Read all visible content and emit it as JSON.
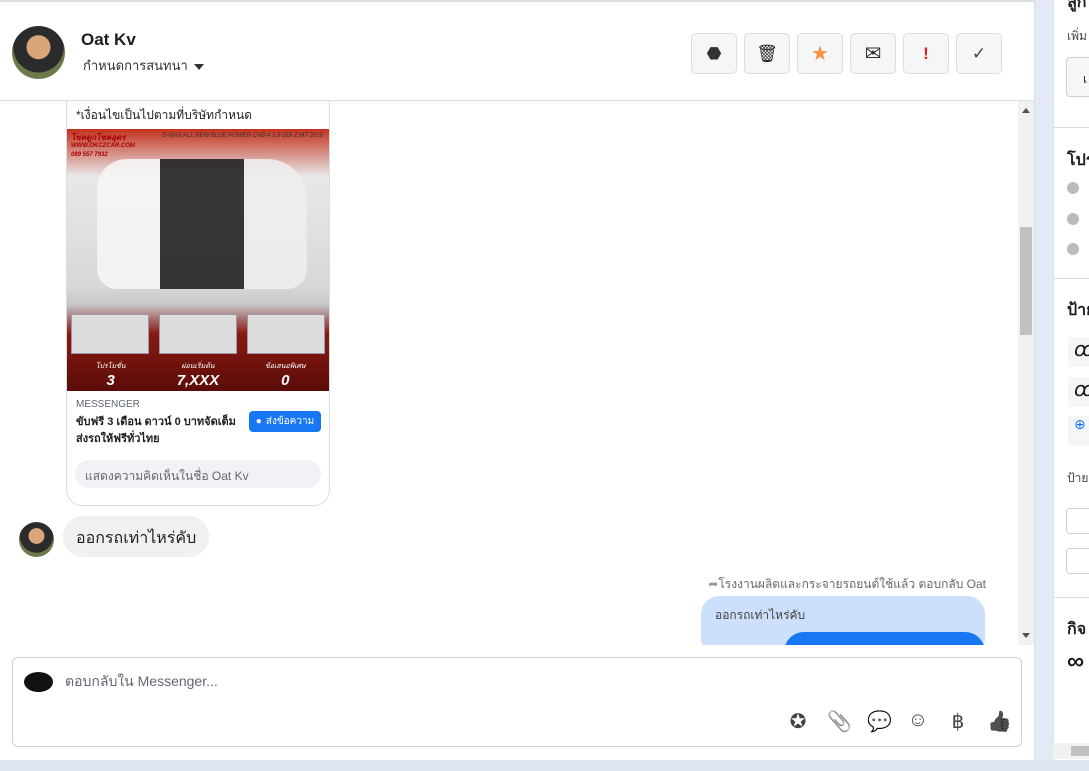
{
  "header": {
    "name": "Oat Kv",
    "assign_label": "กำหนดการสนทนา",
    "actions": [
      {
        "icon": "spam-icon",
        "glyph": "⬣"
      },
      {
        "icon": "trash-icon",
        "glyph": "🗑"
      },
      {
        "icon": "star-icon",
        "glyph": "★",
        "color": "#f7923a"
      },
      {
        "icon": "mail-icon",
        "glyph": "✉"
      },
      {
        "icon": "important-icon",
        "glyph": "!",
        "color": "#e02020"
      },
      {
        "icon": "check-icon",
        "glyph": "✓"
      }
    ]
  },
  "ad_card": {
    "condition_text": "*เงื่อนไขเป็นไปตามที่บริษัทกำหนด",
    "brand": "โชคดูกโชคอุดร",
    "site": "WWW.OKCZCAR.COM",
    "phone": "089 557 7932",
    "model": "D-MAX ALL NEW BLUE POWER CAB-4 1.9 DDI Z MT 2019",
    "promos": [
      {
        "label": "โปรโมชั่น",
        "value": "3"
      },
      {
        "label": "ผ่อนเริ่มต้น",
        "value": "7,XXX"
      },
      {
        "label": "ข้อเสนอพิเศษ",
        "value": "0"
      }
    ],
    "source": "MESSENGER",
    "title": "ขับฟรี 3 เดือน ดาวน์ 0 บาทจัดเต็ม ส่งรถให้ฟรีทั่วไทย",
    "send_label": "ส่งข้อความ",
    "comment_placeholder": "แสดงความคิดเห็นในชื่อ Oat Kv"
  },
  "messages": {
    "incoming": "ออกรถเท่าไหร่คับ",
    "reply_meta": "โรงงานผลิตและกระจายรถยนต์ใช้แล้ว ตอบกลับ Oat",
    "quoted": "ออกรถเท่าไหร่คับ"
  },
  "composer": {
    "placeholder": "ตอบกลับใน Messenger...",
    "tools": [
      {
        "icon": "saved-reply-icon",
        "glyph": "✪"
      },
      {
        "icon": "attachment-icon",
        "glyph": "📎"
      },
      {
        "icon": "chat-icon",
        "glyph": "💬"
      },
      {
        "icon": "emoji-icon",
        "glyph": "☺"
      },
      {
        "icon": "baht-icon",
        "glyph": "฿"
      },
      {
        "icon": "like-icon",
        "glyph": "👍"
      }
    ]
  },
  "right_panel": {
    "top_cut": "ลูก",
    "add_label": "เพิ่ม",
    "add_button": "เ",
    "profile_title": "โปร",
    "labels_title": "ป้าย",
    "tag1": "ꝏ",
    "tag2": "ꝏ",
    "labels_sub": "ป้าย",
    "activity_title": "กิจ",
    "activity_icon": "∞"
  }
}
